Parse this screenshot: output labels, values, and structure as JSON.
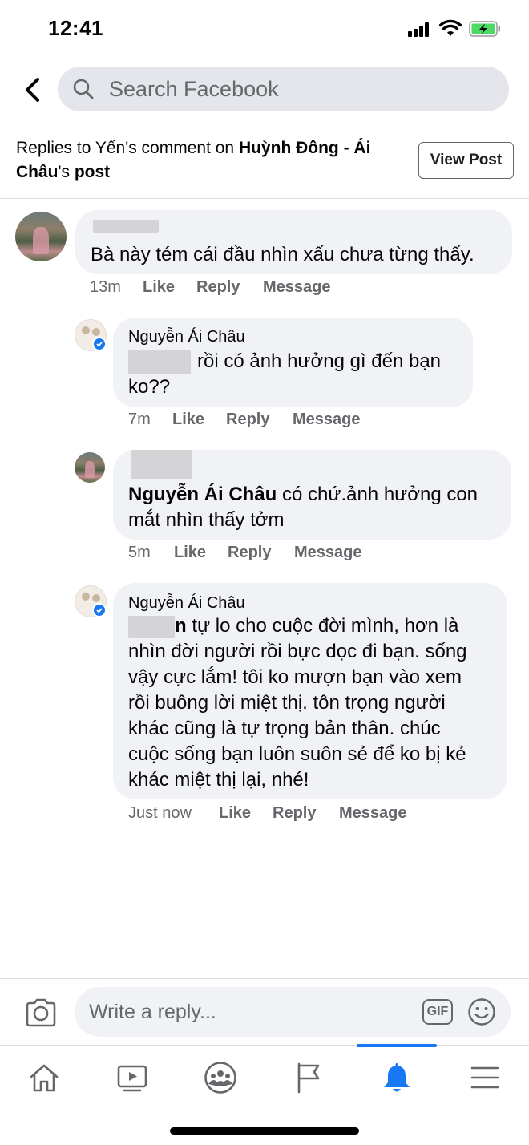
{
  "status_bar": {
    "time": "12:41"
  },
  "search": {
    "placeholder": "Search Facebook"
  },
  "context": {
    "prefix": "Replies to Yến's comment on ",
    "page_name": "Huỳnh Đông - Ái Châu",
    "suffix_a": "'s ",
    "suffix_b": "post",
    "view_post_label": "View Post"
  },
  "comments": [
    {
      "author": "",
      "text": "Bà này tém cái đầu nhìn xấu chưa từng thấy.",
      "time": "13m",
      "like": "Like",
      "reply": "Reply",
      "message": "Message"
    },
    {
      "author": "Nguyễn Ái Châu",
      "line1_suffix": "rồi có ảnh hưởng gì đến bạn",
      "line2": "ko??",
      "time": "7m",
      "like": "Like",
      "reply": "Reply",
      "message": "Message"
    },
    {
      "author": "",
      "mention": "Nguyễn Ái Châu",
      "line1_suffix": " có chứ.ảnh hưởng con",
      "line2": "mắt nhìn thấy tởm",
      "time": "5m",
      "like": "Like",
      "reply": "Reply",
      "message": "Message"
    },
    {
      "author": "Nguyễn Ái Châu",
      "mention_tail": "n",
      "line1_suffix": " tự lo cho cuộc đời mình, hơn là",
      "lines": [
        "nhìn đời người rồi bực dọc đi bạn. sống",
        "vậy cực lắm! tôi ko mượn bạn vào xem",
        "rồi buông lời miệt thị. tôn trọng người",
        "khác cũng là tự trọng bản thân. chúc",
        "cuộc sống bạn luôn suôn sẻ để ko bị kẻ",
        "khác miệt thị lại, nhé!"
      ],
      "time": "Just now",
      "like": "Like",
      "reply": "Reply",
      "message": "Message"
    }
  ],
  "composer": {
    "placeholder": "Write a reply...",
    "gif_label": "GIF"
  },
  "nav": {
    "items": [
      "home-icon",
      "watch-icon",
      "groups-icon",
      "pages-icon",
      "notifications-icon",
      "menu-icon"
    ],
    "active": "notifications-icon",
    "active_color": "#1877f2"
  },
  "colors": {
    "bubble": "#f0f2f5",
    "secondary_text": "#65676b",
    "brand_blue": "#1877f2"
  }
}
